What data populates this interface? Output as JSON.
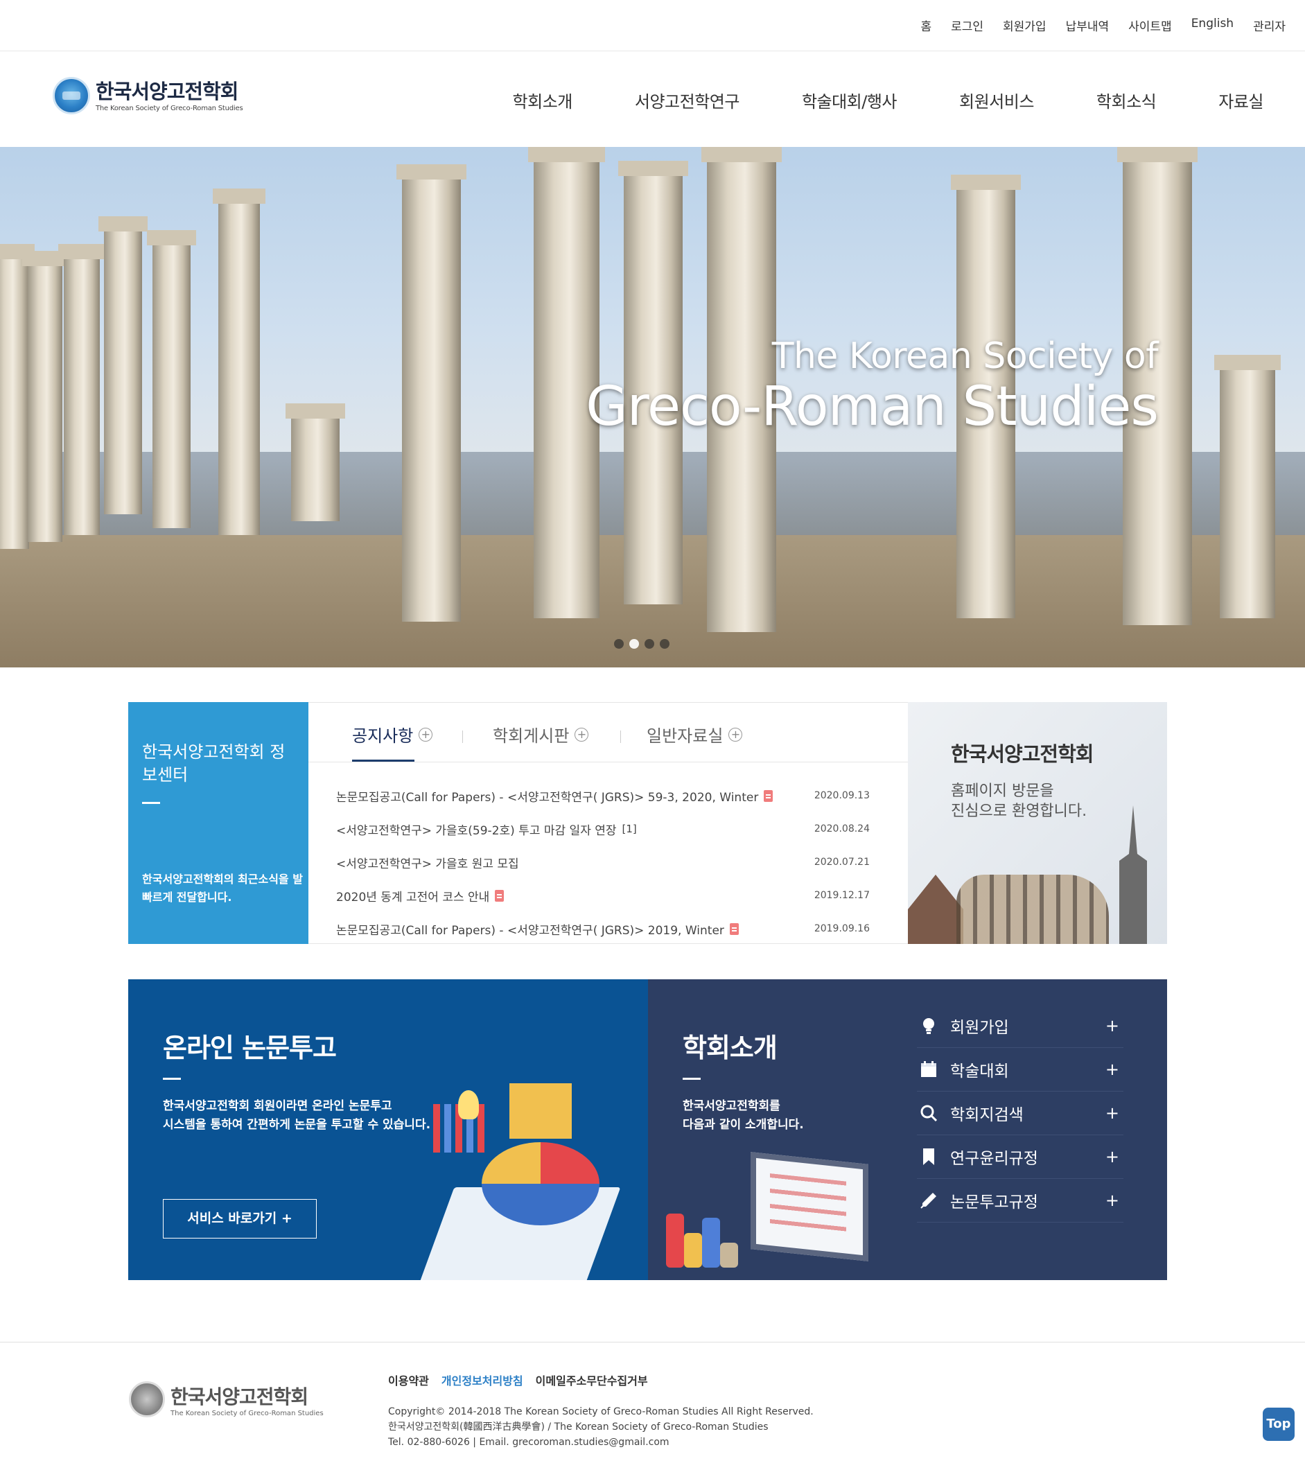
{
  "util_nav": [
    "홈",
    "로그인",
    "회원가입",
    "납부내역",
    "사이트맵",
    "English",
    "관리자"
  ],
  "logo": {
    "name_ko": "한국서양고전학회",
    "name_en": "The Korean Society of Greco-Roman Studies"
  },
  "gnb": [
    "학회소개",
    "서양고전학연구",
    "학술대회/행사",
    "회원서비스",
    "학회소식",
    "자료실"
  ],
  "hero": {
    "line1": "The Korean Society of",
    "line2": "Greco-Roman Studies",
    "slide_count": 4,
    "active_slide": 1
  },
  "info_center": {
    "title": "한국서양고전학회 정보센터",
    "desc": "한국서양고전학회의 최근소식을 발 빠르게 전달합니다."
  },
  "tabs": [
    {
      "label": "공지사항",
      "active": true
    },
    {
      "label": "학회게시판",
      "active": false
    },
    {
      "label": "일반자료실",
      "active": false
    }
  ],
  "notices": [
    {
      "title": "논문모집공고(Call for Papers) - <서양고전학연구( JGRS)> 59-3, 2020, Winter",
      "file": true,
      "count": "",
      "date": "2020.09.13"
    },
    {
      "title": "<서양고전학연구> 가을호(59-2호) 투고 마감 일자 연장",
      "file": false,
      "count": "[1]",
      "date": "2020.08.24"
    },
    {
      "title": "<서양고전학연구> 가을호 원고 모집",
      "file": false,
      "count": "",
      "date": "2020.07.21"
    },
    {
      "title": "2020년 동계 고전어 코스 안내",
      "file": true,
      "count": "",
      "date": "2019.12.17"
    },
    {
      "title": "논문모집공고(Call for Papers) - <서양고전학연구( JGRS)> 2019, Winter",
      "file": true,
      "count": "",
      "date": "2019.09.16"
    }
  ],
  "welcome": {
    "title": "한국서양고전학회",
    "line1": "홈페이지 방문을",
    "line2": "진심으로 환영합니다."
  },
  "submission": {
    "title": "온라인 논문투고",
    "line1": "한국서양고전학회 회원이라면 온라인 논문투고",
    "line2": "시스템을 통하여 간편하게 논문을 투고할 수 있습니다.",
    "button": "서비스 바로가기 +"
  },
  "intro": {
    "title": "학회소개",
    "line1": "한국서양고전학회를",
    "line2": "다음과 같이 소개합니다."
  },
  "quick_links": [
    {
      "label": "회원가입",
      "icon": "lightbulb-icon"
    },
    {
      "label": "학술대회",
      "icon": "calendar-icon"
    },
    {
      "label": "학회지검색",
      "icon": "search-icon"
    },
    {
      "label": "연구윤리규정",
      "icon": "bookmark-icon"
    },
    {
      "label": "논문투고규정",
      "icon": "pen-icon"
    }
  ],
  "quick_plus": "+",
  "footer": {
    "links": [
      "이용약관",
      "개인정보처리방침",
      "이메일주소무단수집거부"
    ],
    "copyright": "Copyright© 2014-2018 The Korean Society of Greco-Roman Studies All Right Reserved.",
    "org": "한국서양고전학회(韓國西洋古典學會) / The Korean Society of Greco-Roman Studies",
    "contact": "Tel. 02-880-6026 | Email. grecoroman.studies@gmail.com"
  },
  "top_button": "Top",
  "colors": {
    "info_blue": "#2f9ad4",
    "submission_blue": "#0a5394",
    "intro_navy": "#2d3e63",
    "tab_active": "#1d3d6d"
  }
}
